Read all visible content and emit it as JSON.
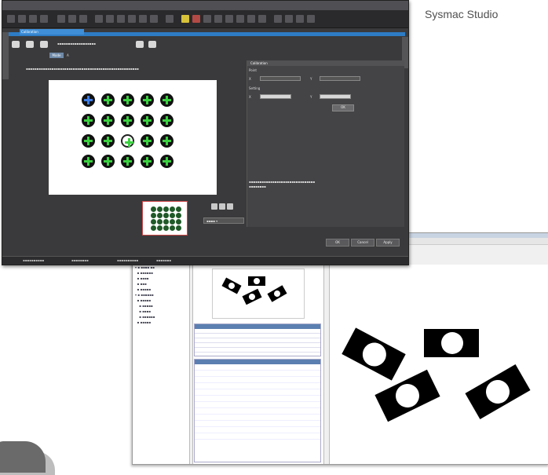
{
  "brand": {
    "label": "Sysmac Studio"
  },
  "front_window": {
    "tab_title": "Calibration",
    "mode_button": "Mode",
    "mode_value": "A",
    "panel_title": "Calibration",
    "panel_section_a": "Point",
    "panel_section_b": "Setting",
    "panel_button": "OK",
    "bottom_buttons": [
      "OK",
      "Cancel",
      "Apply"
    ]
  },
  "colors": {
    "accent": "#2d7bc4",
    "crosshair": "#3ad13f",
    "selected_crosshair": "#3c7de8",
    "thumbnail_border": "#cc4444"
  },
  "icons": [
    "crosshair-icon",
    "toolbar-icon",
    "zoom-icon"
  ]
}
